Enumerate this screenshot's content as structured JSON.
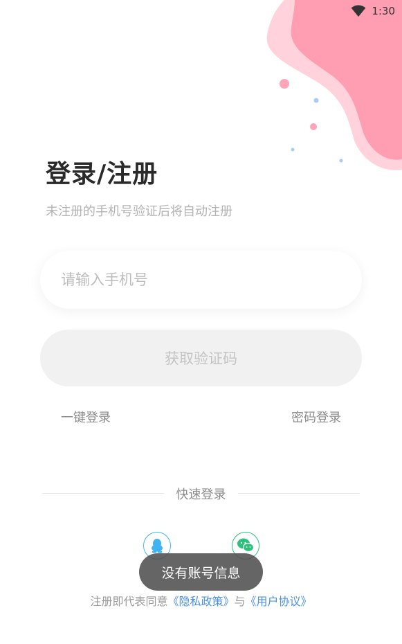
{
  "status_bar": {
    "time": "1:30"
  },
  "login": {
    "title": "登录/注册",
    "subtitle": "未注册的手机号验证后将自动注册",
    "phone_placeholder": "请输入手机号",
    "get_code_label": "获取验证码",
    "one_click_label": "一键登录",
    "password_login_label": "密码登录",
    "quick_login_label": "快速登录"
  },
  "social": {
    "qq_icon": "qq-icon",
    "wechat_icon": "wechat-icon"
  },
  "toast": {
    "message": "没有账号信息"
  },
  "agreement": {
    "prefix": "注册即代表同意",
    "privacy": "《隐私政策》",
    "and": "与",
    "user_agreement": "《用户协议》"
  },
  "colors": {
    "accent_pink": "#ff8fa8",
    "link_blue": "#4a90e2",
    "qq_blue": "#3fb4f0",
    "wechat_green": "#2cc17a",
    "button_disabled": "#f1f1f1"
  }
}
